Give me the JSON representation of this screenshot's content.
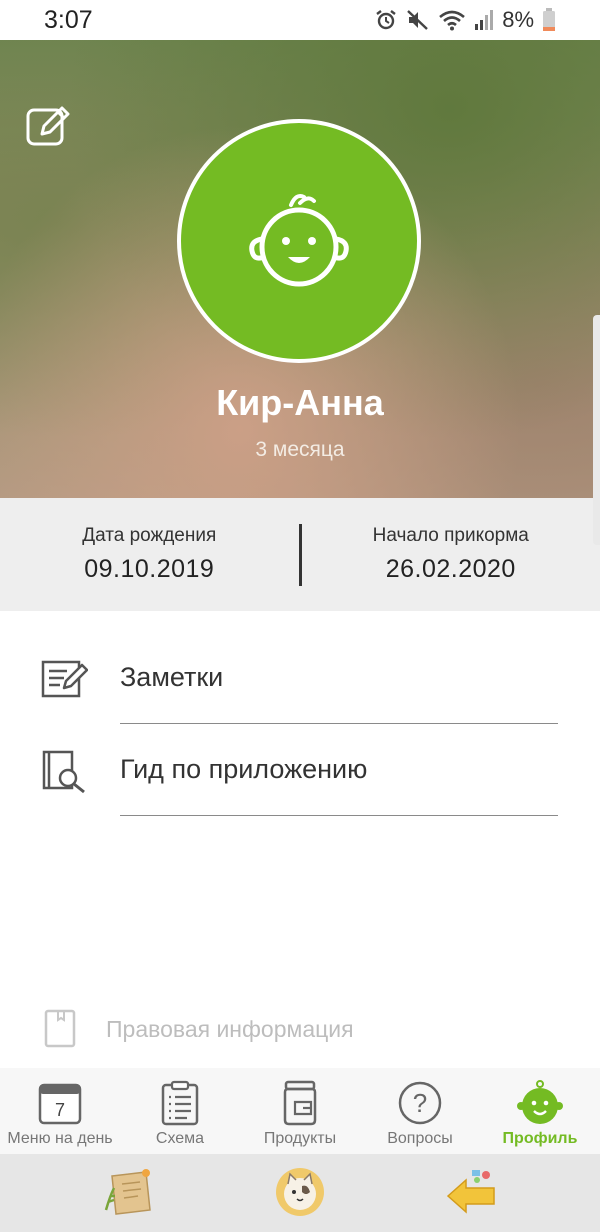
{
  "status_bar": {
    "time": "3:07",
    "battery": "8%",
    "icons": [
      "alarm-icon",
      "mute-icon",
      "wifi-icon",
      "signal-icon",
      "battery-icon"
    ]
  },
  "profile": {
    "name": "Кир-Анна",
    "age": "3 месяца",
    "avatar_icon": "baby-face-icon",
    "edit_icon": "edit-icon",
    "accent_color": "#74bb23"
  },
  "info": {
    "birth_label": "Дата рождения",
    "birth_value": "09.10.2019",
    "feeding_label": "Начало прикорма",
    "feeding_value": "26.02.2020"
  },
  "menu": {
    "notes": "Заметки",
    "guide": "Гид по приложению",
    "legal": "Правовая информация"
  },
  "bottom_nav": {
    "items": [
      {
        "label": "Меню на день",
        "icon": "calendar-icon",
        "badge": "7"
      },
      {
        "label": "Схема",
        "icon": "clipboard-icon"
      },
      {
        "label": "Продукты",
        "icon": "jar-icon"
      },
      {
        "label": "Вопросы",
        "icon": "question-icon"
      },
      {
        "label": "Профиль",
        "icon": "baby-icon",
        "active": true
      }
    ]
  },
  "promo_bar": {
    "icons": [
      "recipe-note-icon",
      "cat-plate-icon",
      "back-arrow-icon"
    ]
  }
}
